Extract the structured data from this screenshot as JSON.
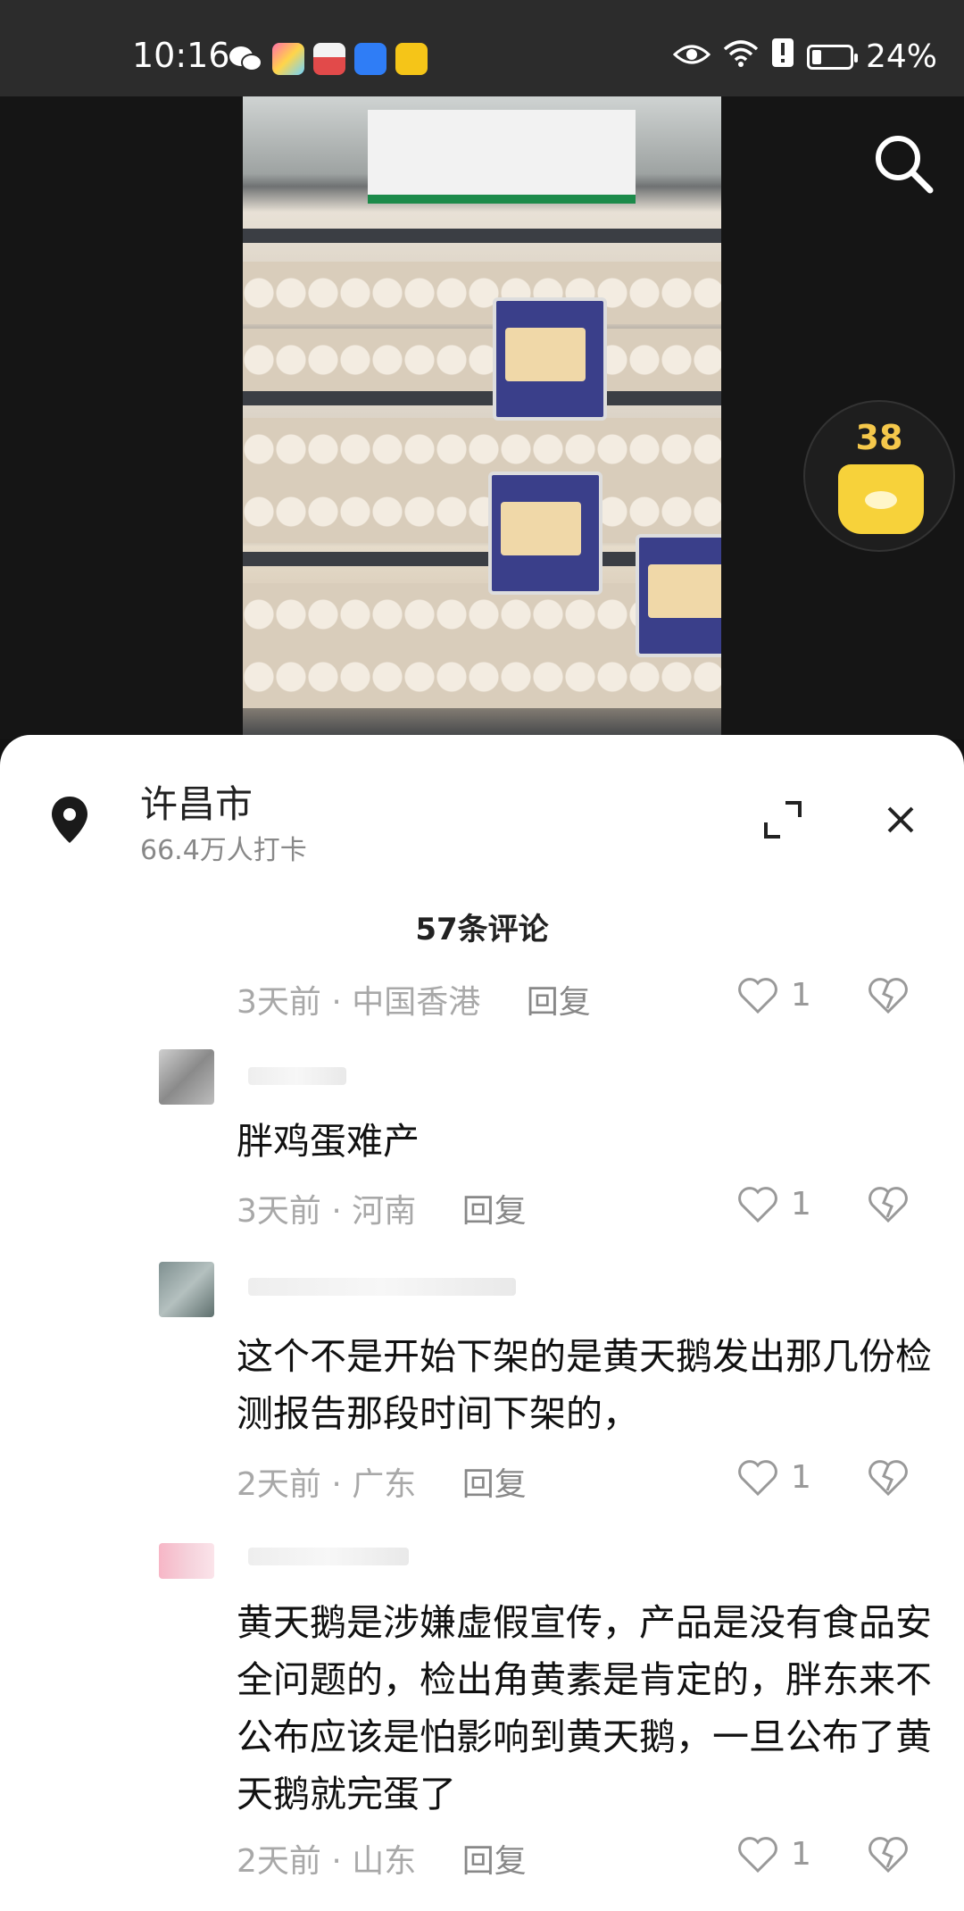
{
  "status_bar": {
    "time": "10:16",
    "battery": "24%"
  },
  "location": {
    "name": "许昌市",
    "checkins": "66.4万人打卡"
  },
  "comment_count": "57条评论",
  "reward": {
    "count": "38"
  },
  "comments": [
    {
      "text": "",
      "time": "3天前",
      "region": "中国香港",
      "reply_label": "回复",
      "likes": "1"
    },
    {
      "text": "胖鸡蛋难产",
      "time": "3天前",
      "region": "河南",
      "reply_label": "回复",
      "likes": "1"
    },
    {
      "text": "这个不是开始下架的是黄天鹅发出那几份检测报告那段时间下架的，",
      "time": "2天前",
      "region": "广东",
      "reply_label": "回复",
      "likes": "1"
    },
    {
      "text": "黄天鹅是涉嫌虚假宣传，产品是没有食品安全问题的，检出角黄素是肯定的，胖东来不公布应该是怕影响到黄天鹅，一旦公布了黄天鹅就完蛋了",
      "time": "2天前",
      "region": "山东",
      "reply_label": "回复",
      "likes": "1"
    }
  ],
  "colors": {
    "coin_bag": "#f7d23a",
    "coin_number": "#f5c84b",
    "meta_text": "#a8a8a8"
  }
}
